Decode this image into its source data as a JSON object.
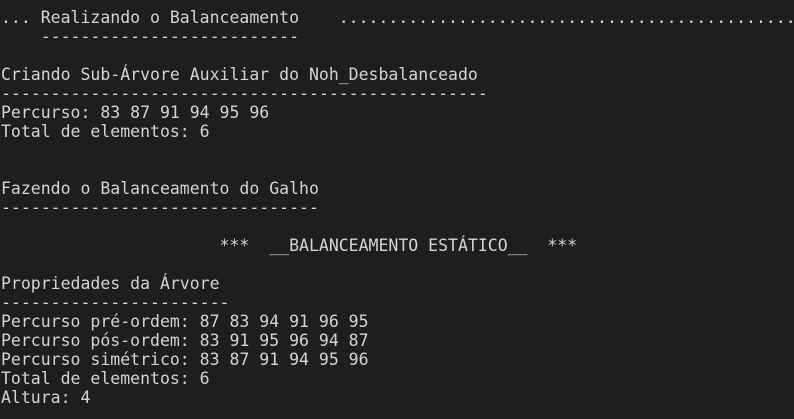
{
  "terminal": {
    "lines": [
      "... Realizando o Balanceamento    ...............................................",
      "    --------------------------",
      "",
      "Criando Sub-Árvore Auxiliar do Noh_Desbalanceado",
      "-------------------------------------------------",
      "Percurso: 83 87 91 94 95 96",
      "Total de elementos: 6",
      "",
      "",
      "Fazendo o Balanceamento do Galho",
      "--------------------------------",
      "",
      "                      ***  __BALANCEAMENTO ESTÁTICO__  ***",
      "",
      "Propriedades da Árvore",
      "-----------------------",
      "Percurso pré-ordem: 87 83 94 91 96 95",
      "Percurso pós-ordem: 83 91 95 96 94 87",
      "Percurso simétrico: 83 87 91 94 95 96",
      "Total de elementos: 6",
      "Altura: 4"
    ]
  }
}
